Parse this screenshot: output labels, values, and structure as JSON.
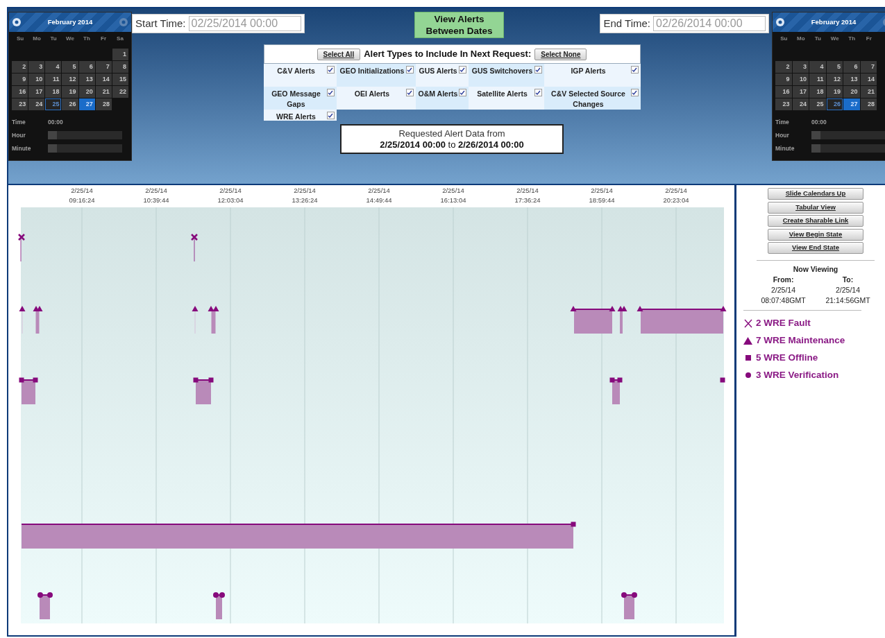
{
  "calendars": [
    {
      "month": "February 2014",
      "weekdays": [
        "Su",
        "Mo",
        "Tu",
        "We",
        "Th",
        "Fr",
        "Sa"
      ],
      "weeks": [
        [
          {
            "label": "1",
            "selected": false,
            "outlined": false
          }
        ],
        [
          {
            "label": "2",
            "selected": false,
            "outlined": false
          },
          {
            "label": "3",
            "selected": false,
            "outlined": false
          },
          {
            "label": "4",
            "selected": false,
            "outlined": false
          },
          {
            "label": "5",
            "selected": false,
            "outlined": false
          },
          {
            "label": "6",
            "selected": false,
            "outlined": false
          },
          {
            "label": "7",
            "selected": false,
            "outlined": false
          },
          {
            "label": "8",
            "selected": false,
            "outlined": false
          }
        ],
        [
          {
            "label": "9",
            "selected": false,
            "outlined": false
          },
          {
            "label": "10",
            "selected": false,
            "outlined": false
          },
          {
            "label": "11",
            "selected": false,
            "outlined": false
          },
          {
            "label": "12",
            "selected": false,
            "outlined": false
          },
          {
            "label": "13",
            "selected": false,
            "outlined": false
          },
          {
            "label": "14",
            "selected": false,
            "outlined": false
          },
          {
            "label": "15",
            "selected": false,
            "outlined": false
          }
        ],
        [
          {
            "label": "16",
            "selected": false,
            "outlined": false
          },
          {
            "label": "17",
            "selected": false,
            "outlined": false
          },
          {
            "label": "18",
            "selected": false,
            "outlined": false
          },
          {
            "label": "19",
            "selected": false,
            "outlined": false
          },
          {
            "label": "20",
            "selected": false,
            "outlined": false
          },
          {
            "label": "21",
            "selected": false,
            "outlined": false
          },
          {
            "label": "22",
            "selected": false,
            "outlined": false
          }
        ],
        [
          {
            "label": "23",
            "selected": false,
            "outlined": false
          },
          {
            "label": "24",
            "selected": false,
            "outlined": false
          },
          {
            "label": "25",
            "selected": false,
            "outlined": true
          },
          {
            "label": "26",
            "selected": false,
            "outlined": false
          },
          {
            "label": "27",
            "selected": true,
            "outlined": false
          },
          {
            "label": "28",
            "selected": false,
            "outlined": false
          }
        ]
      ],
      "time_label": "Time",
      "time_value": "00:00",
      "sliders": [
        {
          "label": "Hour",
          "level": 0
        },
        {
          "label": "Minute",
          "level": 0
        }
      ]
    },
    {
      "month": "February 2014",
      "weekdays": [
        "Su",
        "Mo",
        "Tu",
        "We",
        "Th",
        "Fr"
      ],
      "weeks": [
        [
          {
            "label": "2",
            "selected": false,
            "outlined": false
          },
          {
            "label": "3",
            "selected": false,
            "outlined": false
          },
          {
            "label": "4",
            "selected": false,
            "outlined": false
          },
          {
            "label": "5",
            "selected": false,
            "outlined": false
          },
          {
            "label": "6",
            "selected": false,
            "outlined": false
          },
          {
            "label": "7",
            "selected": false,
            "outlined": false
          }
        ],
        [
          {
            "label": "9",
            "selected": false,
            "outlined": false
          },
          {
            "label": "10",
            "selected": false,
            "outlined": false
          },
          {
            "label": "11",
            "selected": false,
            "outlined": false
          },
          {
            "label": "12",
            "selected": false,
            "outlined": false
          },
          {
            "label": "13",
            "selected": false,
            "outlined": false
          },
          {
            "label": "14",
            "selected": false,
            "outlined": false
          }
        ],
        [
          {
            "label": "16",
            "selected": false,
            "outlined": false
          },
          {
            "label": "17",
            "selected": false,
            "outlined": false
          },
          {
            "label": "18",
            "selected": false,
            "outlined": false
          },
          {
            "label": "19",
            "selected": false,
            "outlined": false
          },
          {
            "label": "20",
            "selected": false,
            "outlined": false
          },
          {
            "label": "21",
            "selected": false,
            "outlined": false
          }
        ],
        [
          {
            "label": "23",
            "selected": false,
            "outlined": false
          },
          {
            "label": "24",
            "selected": false,
            "outlined": false
          },
          {
            "label": "25",
            "selected": false,
            "outlined": false
          },
          {
            "label": "26",
            "selected": false,
            "outlined": true
          },
          {
            "label": "27",
            "selected": true,
            "outlined": false
          },
          {
            "label": "28",
            "selected": false,
            "outlined": false
          }
        ]
      ],
      "time_label": "Time",
      "time_value": "00:00",
      "sliders": [
        {
          "label": "Hour",
          "level": 0
        },
        {
          "label": "Minute",
          "level": 0
        }
      ]
    }
  ],
  "start_time": {
    "label": "Start Time:",
    "value": "02/25/2014 00:00"
  },
  "view_button": {
    "label": "View Alerts Between Dates"
  },
  "end_time": {
    "label": "End Time:",
    "value": "02/26/2014 00:00"
  },
  "alert_types": {
    "select_all": "Select All",
    "title": "Alert Types to Include In Next Request:",
    "select_none": "Select None",
    "items": [
      {
        "label": "C&V Alerts",
        "checked": true
      },
      {
        "label": "GEO Initializations",
        "checked": true
      },
      {
        "label": "GUS Alerts",
        "checked": true
      },
      {
        "label": "GUS Switchovers",
        "checked": true
      },
      {
        "label": "IGP Alerts",
        "checked": true
      },
      {
        "label": "GEO Message Gaps",
        "checked": true
      },
      {
        "label": "OEI Alerts",
        "checked": true
      },
      {
        "label": "O&M Alerts",
        "checked": true
      },
      {
        "label": "Satellite Alerts",
        "checked": true
      },
      {
        "label": "C&V Selected Source Changes",
        "checked": true
      },
      {
        "label": "WRE Alerts",
        "checked": true
      }
    ]
  },
  "requested": {
    "title": "Requested Alert Data from",
    "range": "**2/25/2014 00:00** to **2/26/2014 00:00**"
  },
  "timeline": {
    "ticks": [
      {
        "date": "2/25/14",
        "time": "09:16:24"
      },
      {
        "date": "2/25/14",
        "time": "10:39:44"
      },
      {
        "date": "2/25/14",
        "time": "12:03:04"
      },
      {
        "date": "2/25/14",
        "time": "13:26:24"
      },
      {
        "date": "2/25/14",
        "time": "14:49:44"
      },
      {
        "date": "2/25/14",
        "time": "16:13:04"
      },
      {
        "date": "2/25/14",
        "time": "17:36:24"
      },
      {
        "date": "2/25/14",
        "time": "18:59:44"
      },
      {
        "date": "2/25/14",
        "time": "20:23:04"
      }
    ]
  },
  "side_panel": {
    "buttons": [
      "Slide Calendars Up",
      "Tabular View",
      "Create Sharable Link",
      "View Begin State",
      "View End State"
    ],
    "now_viewing": {
      "title": "Now Viewing",
      "from_label": "From:",
      "from_date": "2/25/14",
      "from_time": "08:07:48GMT",
      "to_label": "To:",
      "to_date": "2/25/14",
      "to_time": "21:14:56GMT"
    },
    "legend": [
      {
        "kind": "fault",
        "label": "2 WRE Fault"
      },
      {
        "kind": "maintenance",
        "label": "7 WRE Maintenance"
      },
      {
        "kind": "offline",
        "label": "5 WRE Offline"
      },
      {
        "kind": "verification",
        "label": "3 WRE Verification"
      }
    ]
  }
}
